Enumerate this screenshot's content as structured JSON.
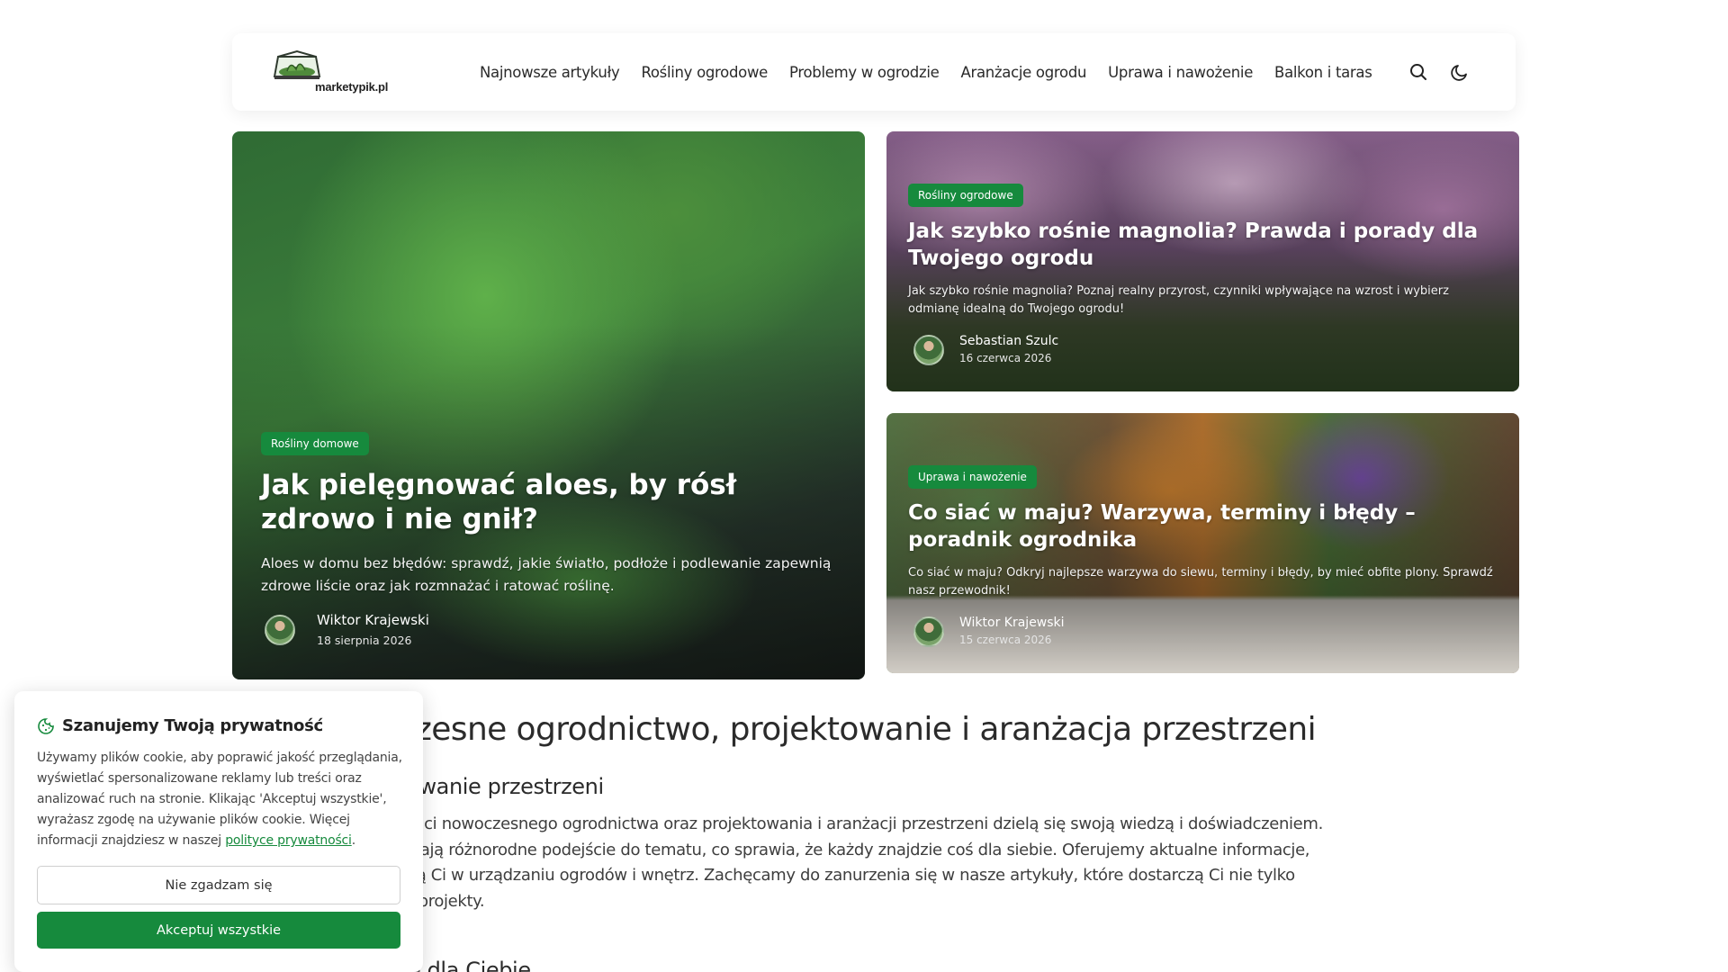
{
  "site": {
    "logo_text": "marketypik.pl"
  },
  "nav": {
    "items": [
      "Najnowsze artykuły",
      "Rośliny ogrodowe",
      "Problemy w ogrodzie",
      "Aranżacje ogrodu",
      "Uprawa i nawożenie",
      "Balkon i taras"
    ],
    "search_icon": "search-icon",
    "theme_icon": "moon-icon"
  },
  "featured": {
    "main": {
      "badge": "Rośliny domowe",
      "title": "Jak pielęgnować aloes, by rósł zdrowo i nie gnił?",
      "description": "Aloes w domu bez błędów: sprawdź, jakie światło, podłoże i podlewanie zapewnią zdrowe liście oraz jak rozmnażać i ratować roślinę.",
      "author": "Wiktor Krajewski",
      "date": "18 sierpnia 2026"
    },
    "top_right": {
      "badge": "Rośliny ogrodowe",
      "title": "Jak szybko rośnie magnolia? Prawda i porady dla Twojego ogrodu",
      "description": "Jak szybko rośnie magnolia? Poznaj realny przyrost, czynniki wpływające na wzrost i wybierz odmianę idealną do Twojego ogrodu!",
      "author": "Sebastian Szulc",
      "date": "16 czerwca 2026"
    },
    "bottom_right": {
      "badge": "Uprawa i nawożenie",
      "title": "Co siać w maju? Warzywa, terminy i błędy – poradnik ogrodnika",
      "description": "Co siać w maju? Odkryj najlepsze warzywa do siewu, terminy i błędy, by mieć obfite plony. Sprawdź nasz przewodnik!",
      "author": "Wiktor Krajewski",
      "date": "15 czerwca 2026"
    }
  },
  "content": {
    "h1": "ive - Nowoczesne ogrodnictwo, projektowanie i aranżacja przestrzeni",
    "h2": "dnictwo i projektowanie przestrzeni",
    "paragraph_lines": [
      "o miejsce, gdzie pasjonaci nowoczesnego ogrodnictwa oraz projektowania i aranżacji przestrzeni dzielą się swoją wiedzą i doświadczeniem.",
      "wielu autorów, którzy mają różnorodne podejście do tematu, co sprawia, że każdy znajdzie coś dla siebie. Oferujemy aktualne informacje,",
      "inspiracje, które pomogą Ci w urządzaniu ogrodów i wnętrz. Zachęcamy do zanurzenia się w nasze artykuły, które dostarczą Ci nie tylko",
      "rch pomysłów na Twoje projekty."
    ],
    "h3": "Artykuły polecane dla Ciebie"
  },
  "cookie": {
    "title": "Szanujemy Twoją prywatność",
    "text_before_link": "Używamy plików cookie, aby poprawić jakość przeglądania, wyświetlać spersonalizowane reklamy lub treści oraz analizować ruch na stronie. Klikając 'Akceptuj wszystkie', wyrażasz zgodę na używanie plików cookie. Więcej informacji znajdziesz w naszej ",
    "link_text": "polityce prywatności",
    "text_after_link": ".",
    "decline_label": "Nie zgadzam się",
    "accept_label": "Akceptuj wszystkie",
    "icon": "cookie-icon"
  },
  "colors": {
    "accent_green": "#168a3d"
  }
}
